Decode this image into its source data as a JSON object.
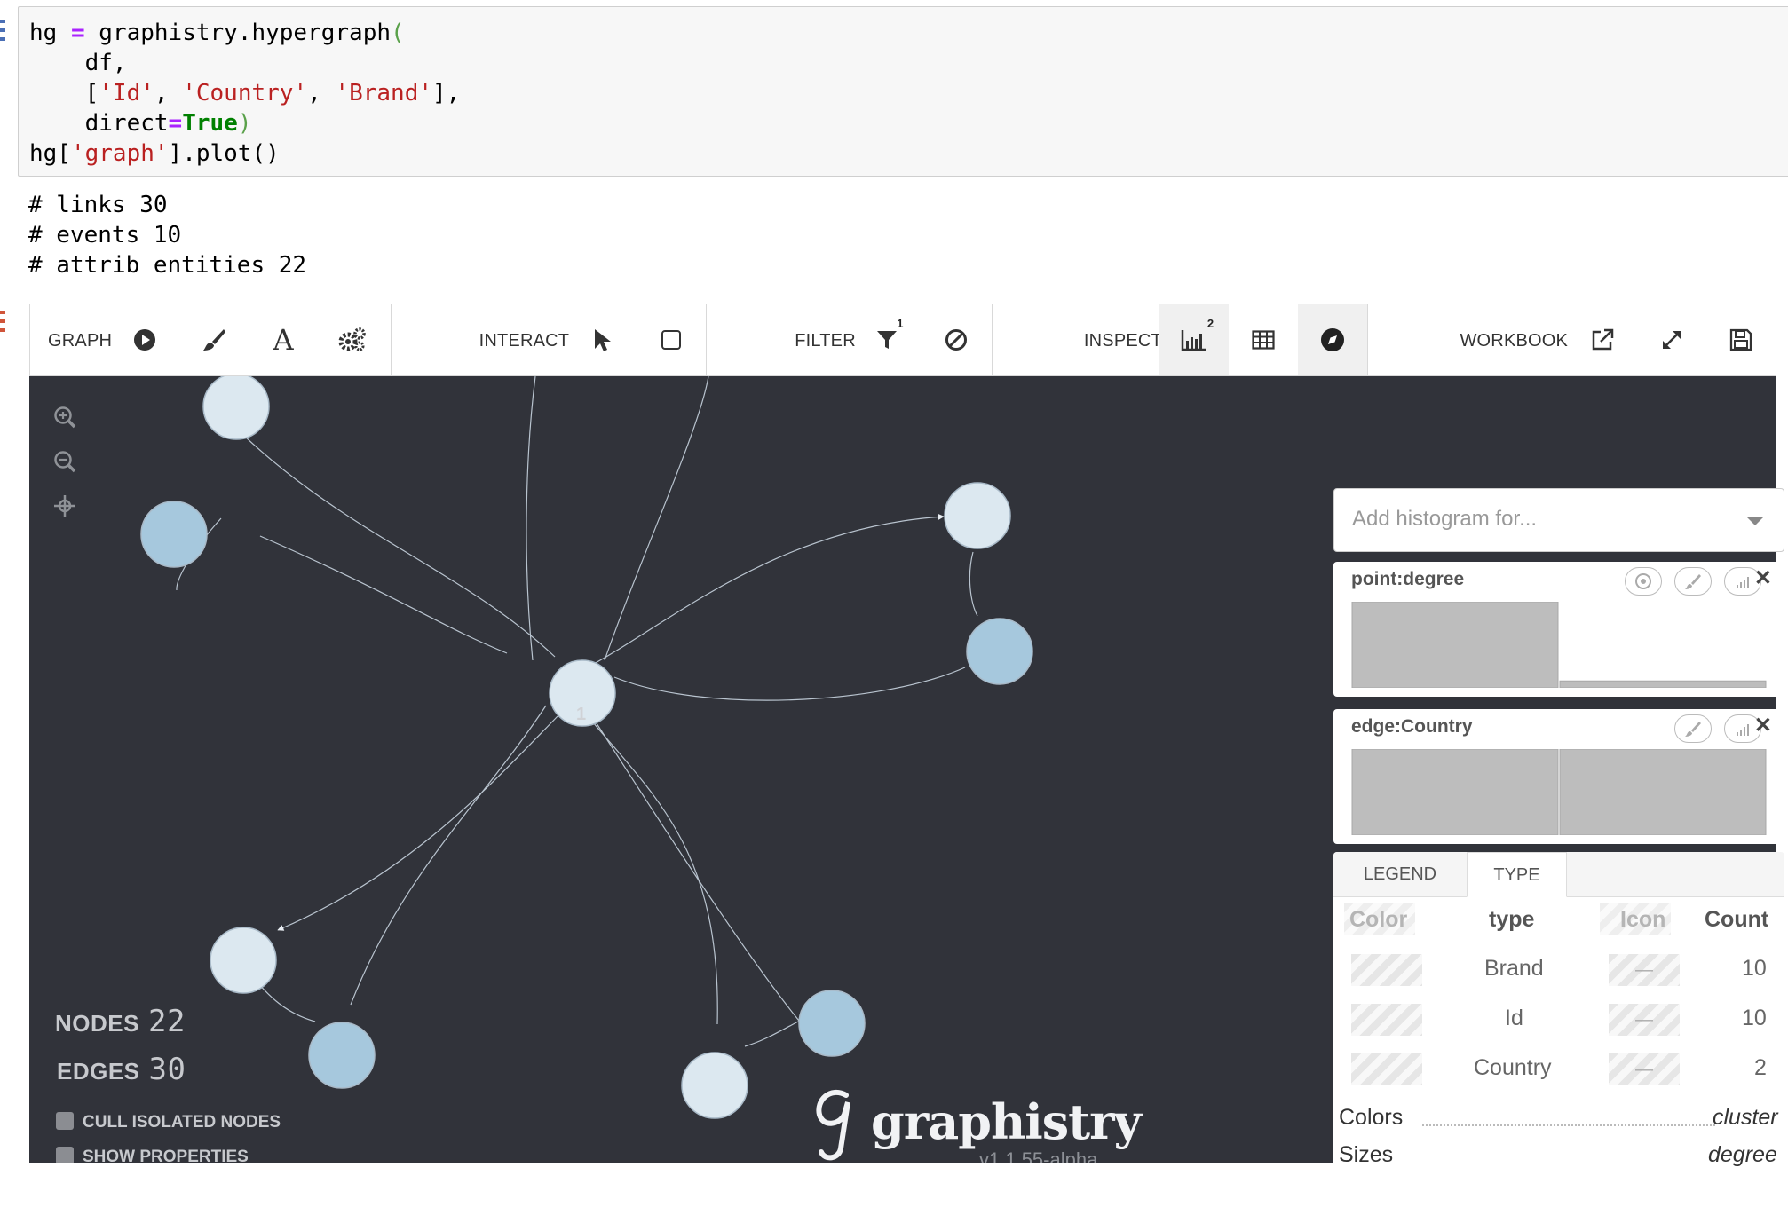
{
  "notebook": {
    "code_lines": [
      {
        "parts": [
          [
            "hg ",
            ""
          ],
          [
            "=",
            "op"
          ],
          [
            " graphistry.hypergraph",
            ""
          ],
          [
            "(",
            "paren"
          ]
        ]
      },
      {
        "parts": [
          [
            "    df,",
            ""
          ]
        ]
      },
      {
        "parts": [
          [
            "    [",
            ""
          ],
          [
            "'Id'",
            "str"
          ],
          [
            ", ",
            ""
          ],
          [
            "'Country'",
            "str"
          ],
          [
            ", ",
            ""
          ],
          [
            "'Brand'",
            "str"
          ],
          [
            "],",
            ""
          ]
        ]
      },
      {
        "parts": [
          [
            "    direct",
            ""
          ],
          [
            "=",
            "op"
          ],
          [
            "True",
            "bool"
          ],
          [
            ")",
            "paren"
          ]
        ]
      },
      {
        "parts": [
          [
            "hg[",
            ""
          ],
          [
            "'graph'",
            "str"
          ],
          [
            "].plot()",
            ""
          ]
        ]
      }
    ],
    "output_lines": [
      "# links 30",
      "# events 10",
      "# attrib entities 22"
    ]
  },
  "toolbar": {
    "graph_label": "GRAPH",
    "interact_label": "INTERACT",
    "filter_label": "FILTER",
    "filter_badge": "1",
    "inspect_label": "INSPECT",
    "inspect_badge": "2",
    "workbook_label": "WORKBOOK"
  },
  "canvas": {
    "node_label": "1",
    "nodes_label": "NODES",
    "nodes_count": "22",
    "edges_label": "EDGES",
    "edges_count": "30",
    "cull_label": "CULL ISOLATED NODES",
    "show_props_label": "SHOW PROPERTIES",
    "brand_name": "graphistry",
    "version": "v1.1.55-alpha"
  },
  "histograms": {
    "placeholder": "Add histogram for...",
    "cards": [
      {
        "title": "point:degree",
        "bins": [
          1.0,
          0.08
        ]
      },
      {
        "title": "edge:Country",
        "bins": [
          1.0,
          1.0
        ]
      }
    ]
  },
  "legend": {
    "tabs": [
      "LEGEND",
      "TYPE"
    ],
    "headers": {
      "color": "Color",
      "type": "type",
      "icon": "Icon",
      "count": "Count"
    },
    "rows": [
      {
        "type": "Brand",
        "icon": "—",
        "count": "10"
      },
      {
        "type": "Id",
        "icon": "—",
        "count": "10"
      },
      {
        "type": "Country",
        "icon": "—",
        "count": "2"
      }
    ],
    "colors_label": "Colors",
    "colors_value": "cluster",
    "sizes_label": "Sizes",
    "sizes_value": "degree"
  },
  "colors": {
    "canvas_bg": "#31333a",
    "node_light": "#dce8f0",
    "node_blue": "#a6c8dd",
    "edge": "#b9c4cf"
  }
}
